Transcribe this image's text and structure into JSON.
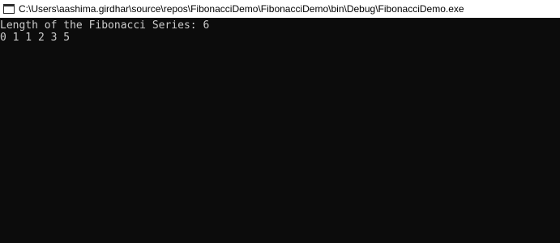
{
  "window": {
    "title": "C:\\Users\\aashima.girdhar\\source\\repos\\FibonacciDemo\\FibonacciDemo\\bin\\Debug\\FibonacciDemo.exe",
    "icon": "console-window-icon"
  },
  "console": {
    "lines": [
      "Length of the Fibonacci Series: 6",
      "0 1 1 2 3 5"
    ],
    "foreground_color": "#cccccc",
    "background_color": "#0c0c0c"
  }
}
